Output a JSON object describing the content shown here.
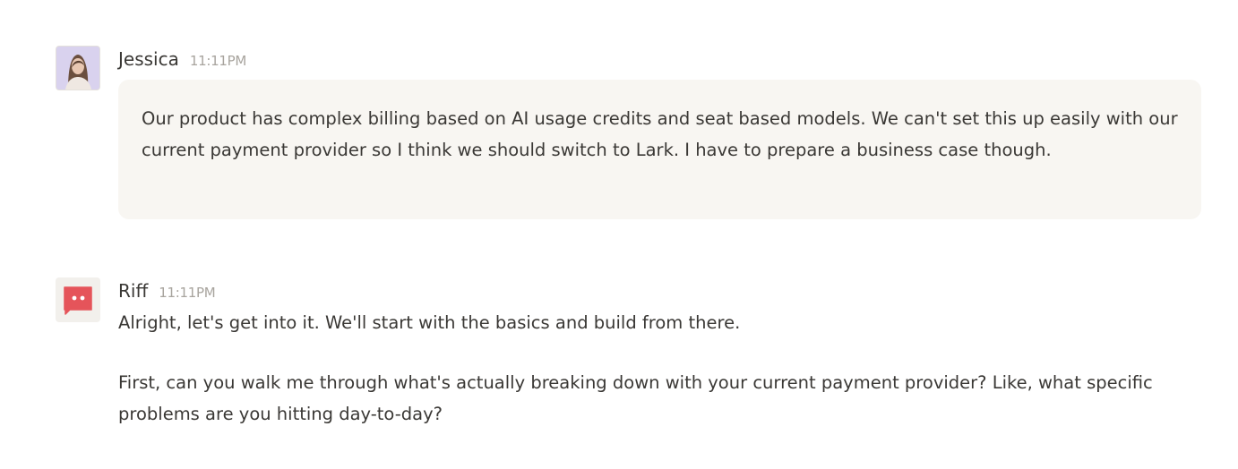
{
  "messages": [
    {
      "sender": "Jessica",
      "time": "11:11PM",
      "avatar": "user-photo-avatar",
      "text": "Our product has complex billing based on AI usage credits and seat based models. We can't set this up easily with our current payment provider so I think we should switch to Lark. I have to prepare a business case though."
    },
    {
      "sender": "Riff",
      "time": "11:11PM",
      "avatar": "chat-bubble-icon",
      "paragraphs": [
        "Alright, let's get into it. We'll start with the basics and build from there.",
        "First, can you walk me through what's actually breaking down with your current payment provider? Like, what specific problems are you hitting day-to-day?"
      ]
    }
  ],
  "colors": {
    "bubble_background": "#f8f6f2",
    "bot_icon": "#e5545a",
    "text": "#3a3835",
    "timestamp": "#a8a49e"
  }
}
